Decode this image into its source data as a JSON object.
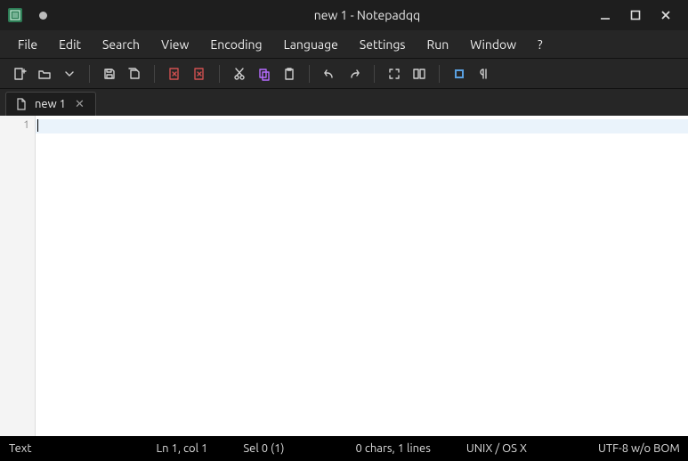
{
  "window": {
    "title": "new 1 - Notepadqq"
  },
  "menu": {
    "items": [
      "File",
      "Edit",
      "Search",
      "View",
      "Encoding",
      "Language",
      "Settings",
      "Run",
      "Window",
      "?"
    ]
  },
  "toolbar": {
    "icons": [
      {
        "name": "new-file-icon",
        "type": "new"
      },
      {
        "name": "open-file-icon",
        "type": "open"
      },
      {
        "name": "dropdown-icon",
        "type": "dropdown"
      },
      {
        "name": "separator"
      },
      {
        "name": "save-icon",
        "type": "save"
      },
      {
        "name": "save-all-icon",
        "type": "saveall"
      },
      {
        "name": "separator"
      },
      {
        "name": "close-tab-icon",
        "type": "closedoc",
        "color": "#d05050"
      },
      {
        "name": "close-all-icon",
        "type": "closedoc",
        "color": "#d05050"
      },
      {
        "name": "separator"
      },
      {
        "name": "cut-icon",
        "type": "cut"
      },
      {
        "name": "copy-icon",
        "type": "copy",
        "color": "#b66cff"
      },
      {
        "name": "paste-icon",
        "type": "paste"
      },
      {
        "name": "separator"
      },
      {
        "name": "undo-icon",
        "type": "undo"
      },
      {
        "name": "redo-icon",
        "type": "redo"
      },
      {
        "name": "separator"
      },
      {
        "name": "fullscreen-icon",
        "type": "fullscreen"
      },
      {
        "name": "wrap-icon",
        "type": "wrap"
      },
      {
        "name": "separator"
      },
      {
        "name": "formatting-icon",
        "type": "grid",
        "color": "#5aa0e0"
      },
      {
        "name": "pilcrow-icon",
        "type": "pilcrow"
      }
    ]
  },
  "tabs": [
    {
      "label": "new 1"
    }
  ],
  "editor": {
    "line_numbers": [
      "1"
    ],
    "content": ""
  },
  "status": {
    "format": "Text",
    "position": "Ln 1, col 1",
    "selection": "Sel 0 (1)",
    "stats": "0 chars, 1 lines",
    "eol": "UNIX / OS X",
    "encoding": "UTF-8 w/o BOM"
  }
}
